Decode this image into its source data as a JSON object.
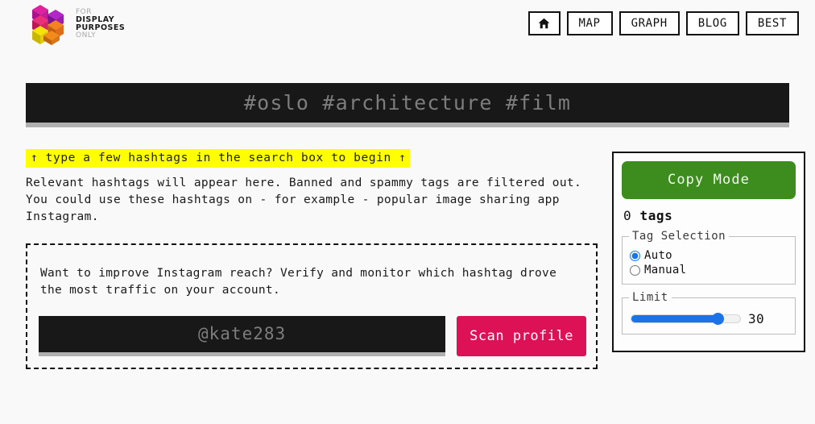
{
  "brand": {
    "logo_icon": "isometric-cubes-logo",
    "line1": "FOR",
    "line2": "DISPLAY",
    "line3": "PURPOSES",
    "line4": "ONLY",
    "colors": {
      "magenta": "#cc1f9b",
      "purple": "#a41fcc",
      "pink": "#e6007e",
      "orange": "#f07d1a",
      "yellow": "#f2e407"
    }
  },
  "nav": {
    "home_icon": "home-icon",
    "items": [
      {
        "label": "MAP"
      },
      {
        "label": "GRAPH"
      },
      {
        "label": "BLOG"
      },
      {
        "label": "BEST"
      }
    ]
  },
  "search": {
    "value": "",
    "placeholder": "#oslo #architecture #film",
    "background": "#181818",
    "underline_color": "#b0b0b0"
  },
  "results": {
    "hint": "↑ type a few hashtags in the search box to begin ↑",
    "hint_background": "#ffff00",
    "blurb": "Relevant hashtags will appear here. Banned and spammy tags are filtered out. You could use these hashtags on - for example - popular image sharing app Instagram."
  },
  "promo": {
    "text": "Want to improve Instagram reach? Verify and monitor which hashtag drove the most traffic on your account.",
    "profile_input": {
      "value": "",
      "placeholder": "@kate283"
    },
    "scan_button": {
      "label": "Scan profile",
      "color": "#dd1155"
    }
  },
  "panel": {
    "copy_mode": {
      "label": "Copy Mode",
      "color": "#3c8c1e"
    },
    "tag_count_number": "0",
    "tag_count_label": "tags",
    "tag_selection": {
      "legend": "Tag Selection",
      "options": [
        {
          "label": "Auto",
          "selected": true
        },
        {
          "label": "Manual",
          "selected": false
        }
      ]
    },
    "limit": {
      "legend": "Limit",
      "value": "30",
      "min": "0",
      "max": "36",
      "accent": "#1a73e8"
    }
  }
}
